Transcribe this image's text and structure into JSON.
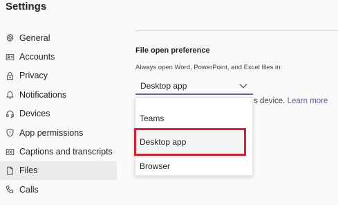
{
  "header": {
    "title": "Settings"
  },
  "sidebar": {
    "items": [
      {
        "label": "General",
        "icon": "gear-icon"
      },
      {
        "label": "Accounts",
        "icon": "id-card-icon"
      },
      {
        "label": "Privacy",
        "icon": "lock-icon"
      },
      {
        "label": "Notifications",
        "icon": "bell-icon"
      },
      {
        "label": "Devices",
        "icon": "headset-icon"
      },
      {
        "label": "App permissions",
        "icon": "shield-icon"
      },
      {
        "label": "Captions and transcripts",
        "icon": "cc-icon"
      },
      {
        "label": "Files",
        "icon": "file-icon",
        "active": true
      },
      {
        "label": "Calls",
        "icon": "phone-icon"
      }
    ]
  },
  "main": {
    "section_title": "File open preference",
    "description": "Always open Word, PowerPoint, and Excel files in:",
    "select": {
      "value": "Desktop app"
    },
    "partial_text": "s device.",
    "learn_more": "Learn more",
    "dropdown": {
      "options": [
        "Teams",
        "Desktop app",
        "Browser"
      ],
      "highlighted": "Desktop app"
    }
  },
  "colors": {
    "accent": "#5b5fc7",
    "highlight_border": "#e01e2b",
    "active_item_bg": "#ebebeb"
  }
}
